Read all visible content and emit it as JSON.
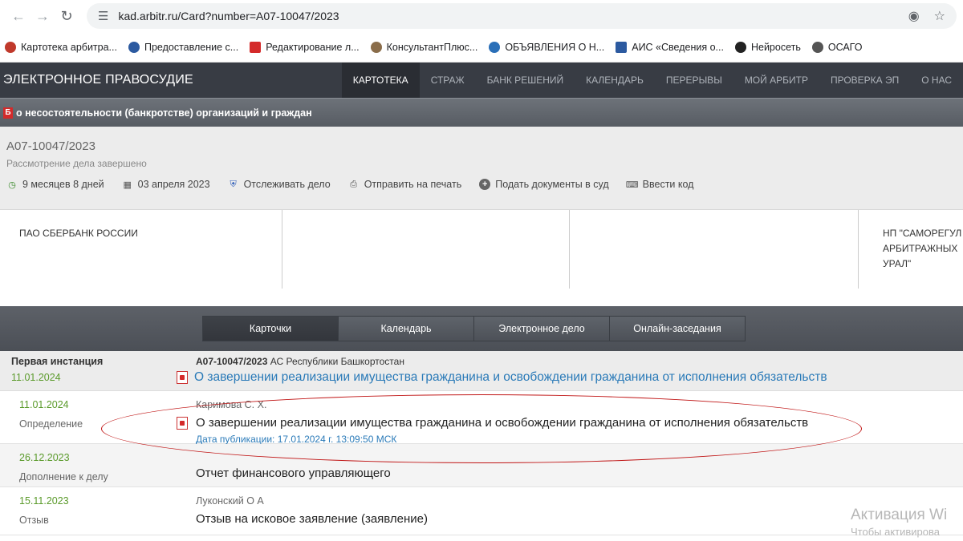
{
  "browser": {
    "url": "kad.arbitr.ru/Card?number=А07-10047/2023"
  },
  "bookmarks": [
    {
      "label": "Картотека арбитра...",
      "color": "#c0392b"
    },
    {
      "label": "Предоставление с...",
      "color": "#2c5aa0"
    },
    {
      "label": "Редактирование л...",
      "color": "#d42a2a"
    },
    {
      "label": "КонсультантПлюс...",
      "color": "#8a6d4a"
    },
    {
      "label": "ОБЪЯВЛЕНИЯ О Н...",
      "color": "#2a6fb8"
    },
    {
      "label": "АИС «Сведения о...",
      "color": "#2c5aa0"
    },
    {
      "label": "Нейросеть",
      "color": "#222222"
    },
    {
      "label": "ОСАГО",
      "color": "#555555"
    }
  ],
  "site": {
    "title": "ЭЛЕКТРОННОЕ ПРАВОСУДИЕ",
    "nav": [
      "КАРТОТЕКА",
      "СТРАЖ",
      "БАНК РЕШЕНИЙ",
      "КАЛЕНДАРЬ",
      "ПЕРЕРЫВЫ",
      "МОЙ АРБИТР",
      "ПРОВЕРКА ЭП",
      "О НАС"
    ],
    "active_nav": "КАРТОТЕКА"
  },
  "category": {
    "badge": "Б",
    "text": "о несостоятельности (банкротстве) организаций и граждан"
  },
  "case": {
    "number": "А07-10047/2023",
    "status": "Рассмотрение дела завершено",
    "duration": "9 месяцев 8 дней",
    "date": "03 апреля 2023",
    "track": "Отслеживать дело",
    "print": "Отправить на печать",
    "submit": "Подать документы в суд",
    "code": "Ввести код"
  },
  "participants": {
    "col1": "ПАО СБЕРБАНК РОССИИ",
    "col2": "",
    "col3": "",
    "col4_line1": "НП \"САМОРЕГУЛ",
    "col4_line2": "АРБИТРАЖНЫХ",
    "col4_line3": "УРАЛ\""
  },
  "tabs": [
    "Карточки",
    "Календарь",
    "Электронное дело",
    "Онлайн-заседания"
  ],
  "instance": {
    "label": "Первая инстанция",
    "date": "11.01.2024",
    "case_number": "А07-10047/2023",
    "court": "АС Республики Башкортостан",
    "link": "О завершении реализации имущества гражданина и освобождении гражданина от исполнения обязательств"
  },
  "entries": [
    {
      "date": "11.01.2024",
      "type": "Определение",
      "judge": "Каримова С. Х.",
      "title": "О завершении реализации имущества гражданина и освобождении гражданина от исполнения обязательств",
      "published": "Дата публикации: 17.01.2024 г. 13:09:50 МСК"
    },
    {
      "date": "26.12.2023",
      "type": "Дополнение к делу",
      "judge": "",
      "title": "Отчет финансового управляющего"
    },
    {
      "date": "15.11.2023",
      "type": "Отзыв",
      "judge": "Луконский О А",
      "title": "Отзыв на исковое заявление (заявление)"
    }
  ],
  "watermark": {
    "line1": "Активация Wi",
    "line2": "Чтобы активирова"
  }
}
